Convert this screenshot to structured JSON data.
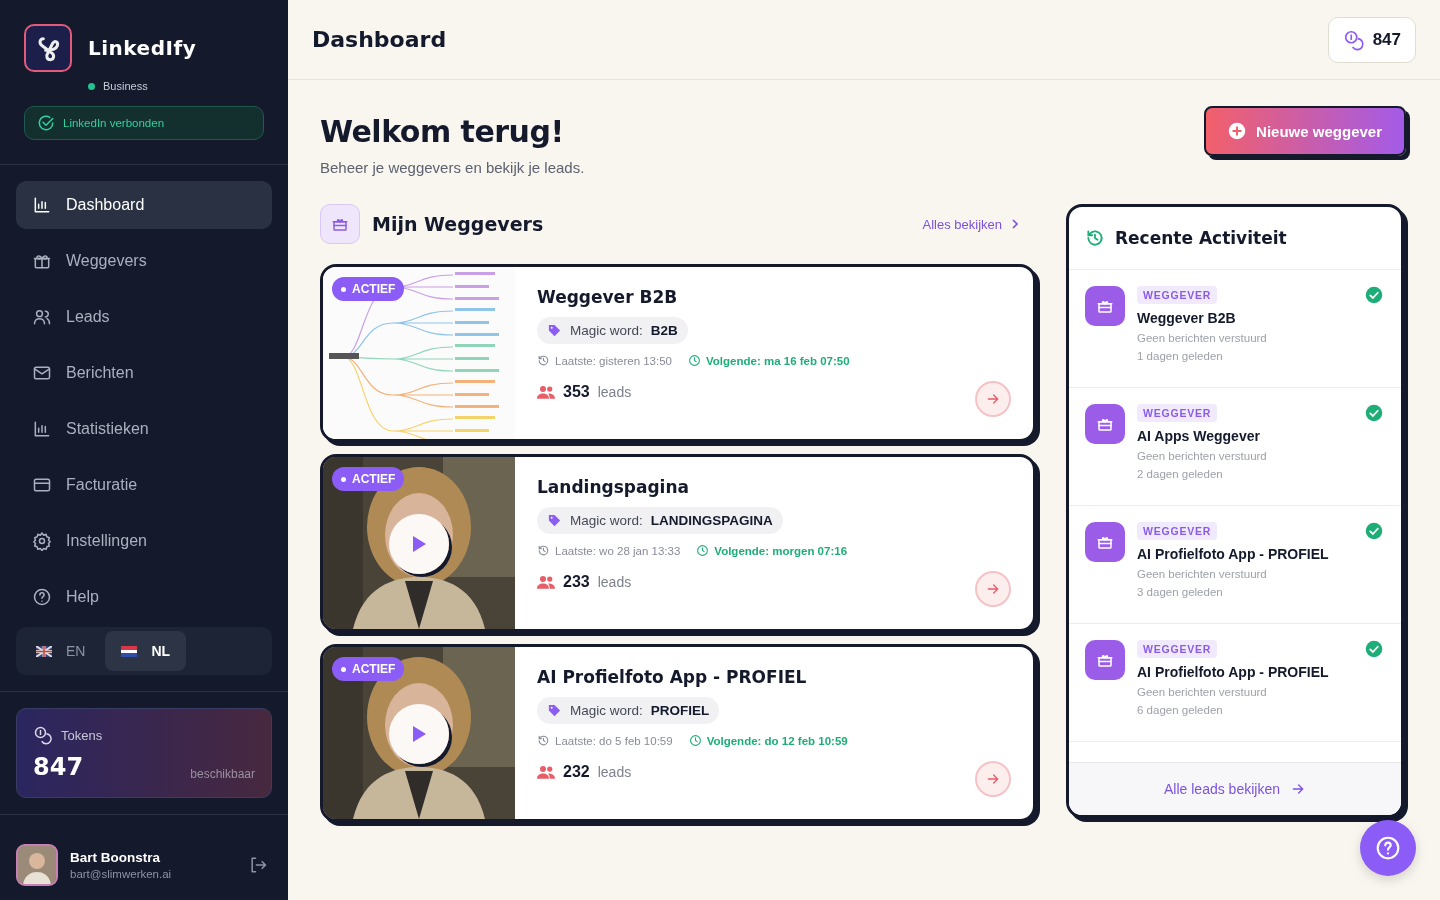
{
  "sidebar": {
    "brand": "LinkedIfy",
    "plan": "Business",
    "linkedin_status": "LinkedIn verbonden",
    "nav": [
      {
        "label": "Dashboard",
        "kind": "chart",
        "selected": true
      },
      {
        "label": "Weggevers",
        "kind": "gift",
        "selected": false
      },
      {
        "label": "Leads",
        "kind": "users",
        "selected": false
      },
      {
        "label": "Berichten",
        "kind": "mail",
        "selected": false
      },
      {
        "label": "Statistieken",
        "kind": "chart",
        "selected": false
      },
      {
        "label": "Facturatie",
        "kind": "card",
        "selected": false
      },
      {
        "label": "Instellingen",
        "kind": "gear",
        "selected": false
      },
      {
        "label": "Help",
        "kind": "help",
        "selected": false
      }
    ],
    "languages": [
      {
        "code": "EN",
        "kind": "uk",
        "selected": false
      },
      {
        "code": "NL",
        "kind": "nl",
        "selected": true
      }
    ],
    "tokens": {
      "label": "Tokens",
      "value": "847",
      "note": "beschikbaar"
    },
    "user": {
      "name": "Bart Boonstra",
      "email": "bart@slimwerken.ai"
    }
  },
  "header": {
    "title": "Dashboard",
    "tokens": "847"
  },
  "welcome": {
    "title": "Welkom terug!",
    "subtitle": "Beheer je weggevers en bekijk je leads.",
    "new_button": "Nieuwe weggever"
  },
  "giveaways": {
    "title": "Mijn Weggevers",
    "view_all": "Alles bekijken",
    "cards": [
      {
        "status": "ACTIEF",
        "kind": "mindmap",
        "title": "Weggever B2B",
        "magic_label": "Magic word:",
        "magic_word": "B2B",
        "last": "Laatste: gisteren 13:50",
        "next": "Volgende: ma 16 feb 07:50",
        "count": "353",
        "count_label": "leads"
      },
      {
        "status": "ACTIEF",
        "kind": "video",
        "title": "Landingspagina",
        "magic_label": "Magic word:",
        "magic_word": "LANDINGSPAGINA",
        "last": "Laatste: wo 28 jan 13:33",
        "next": "Volgende: morgen 07:16",
        "count": "233",
        "count_label": "leads"
      },
      {
        "status": "ACTIEF",
        "kind": "video",
        "title": "AI Profielfoto App - PROFIEL",
        "magic_label": "Magic word:",
        "magic_word": "PROFIEL",
        "last": "Laatste: do 5 feb 10:59",
        "next": "Volgende: do 12 feb 10:59",
        "count": "232",
        "count_label": "leads"
      }
    ]
  },
  "activity": {
    "title": "Recente Activiteit",
    "footer_link": "Alle leads bekijken",
    "items": [
      {
        "tag": "WEGGEVER",
        "title": "Weggever B2B",
        "detail": "Geen berichten verstuurd",
        "time": "1 dagen geleden",
        "done": true
      },
      {
        "tag": "WEGGEVER",
        "title": "AI Apps Weggever",
        "detail": "Geen berichten verstuurd",
        "time": "2 dagen geleden",
        "done": true
      },
      {
        "tag": "WEGGEVER",
        "title": "AI Profielfoto App - PROFIEL",
        "detail": "Geen berichten verstuurd",
        "time": "3 dagen geleden",
        "done": true
      },
      {
        "tag": "WEGGEVER",
        "title": "AI Profielfoto App - PROFIEL",
        "detail": "Geen berichten verstuurd",
        "time": "6 dagen geleden",
        "done": true
      }
    ]
  }
}
